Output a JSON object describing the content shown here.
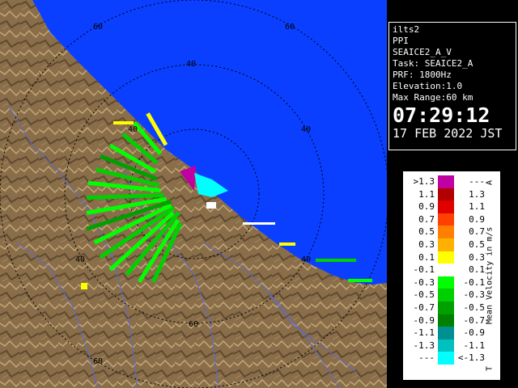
{
  "info": {
    "site": "ilts2",
    "mode": "PPI",
    "product": "SEAICE2_A_V",
    "task": "Task: SEAICE2_A",
    "prf": "PRF: 1800Hz",
    "elevation": "Elevation:1.0",
    "max_range": "Max Range:60 km",
    "time": "07:29:12",
    "date": "17 FEB 2022 JST"
  },
  "legend": {
    "title": "Mean Velocity in m/s",
    "top_marker": "A",
    "bottom_marker": "T",
    "rows": [
      {
        "low": ">1.3",
        "high": "---",
        "color": "#c000a0"
      },
      {
        "low": "1.1",
        "high": "1.3",
        "color": "#b00000"
      },
      {
        "low": "0.9",
        "high": "1.1",
        "color": "#e00000"
      },
      {
        "low": "0.7",
        "high": "0.9",
        "color": "#ff4000"
      },
      {
        "low": "0.5",
        "high": "0.7",
        "color": "#ff8000"
      },
      {
        "low": "0.3",
        "high": "0.5",
        "color": "#ffb000"
      },
      {
        "low": "0.1",
        "high": "0.3",
        "color": "#ffff00"
      },
      {
        "low": "-0.1",
        "high": "0.1",
        "color": "#ffffff"
      },
      {
        "low": "-0.3",
        "high": "-0.1",
        "color": "#00ff00"
      },
      {
        "low": "-0.5",
        "high": "-0.3",
        "color": "#00d000"
      },
      {
        "low": "-0.7",
        "high": "-0.5",
        "color": "#00a000"
      },
      {
        "low": "-0.9",
        "high": "-0.7",
        "color": "#008000"
      },
      {
        "low": "-1.1",
        "high": "-0.9",
        "color": "#009090"
      },
      {
        "low": "-1.3",
        "high": "-1.1",
        "color": "#00c0c0"
      },
      {
        "low": "---",
        "high": "<-1.3",
        "color": "#00ffff"
      }
    ]
  },
  "map": {
    "range_labels": [
      "60",
      "60",
      "40",
      "40",
      "40",
      "40",
      "40",
      "60",
      "60"
    ],
    "colors": {
      "sea": "#0a3fff",
      "land": "#8a6e4a",
      "ring": "#000000"
    }
  }
}
